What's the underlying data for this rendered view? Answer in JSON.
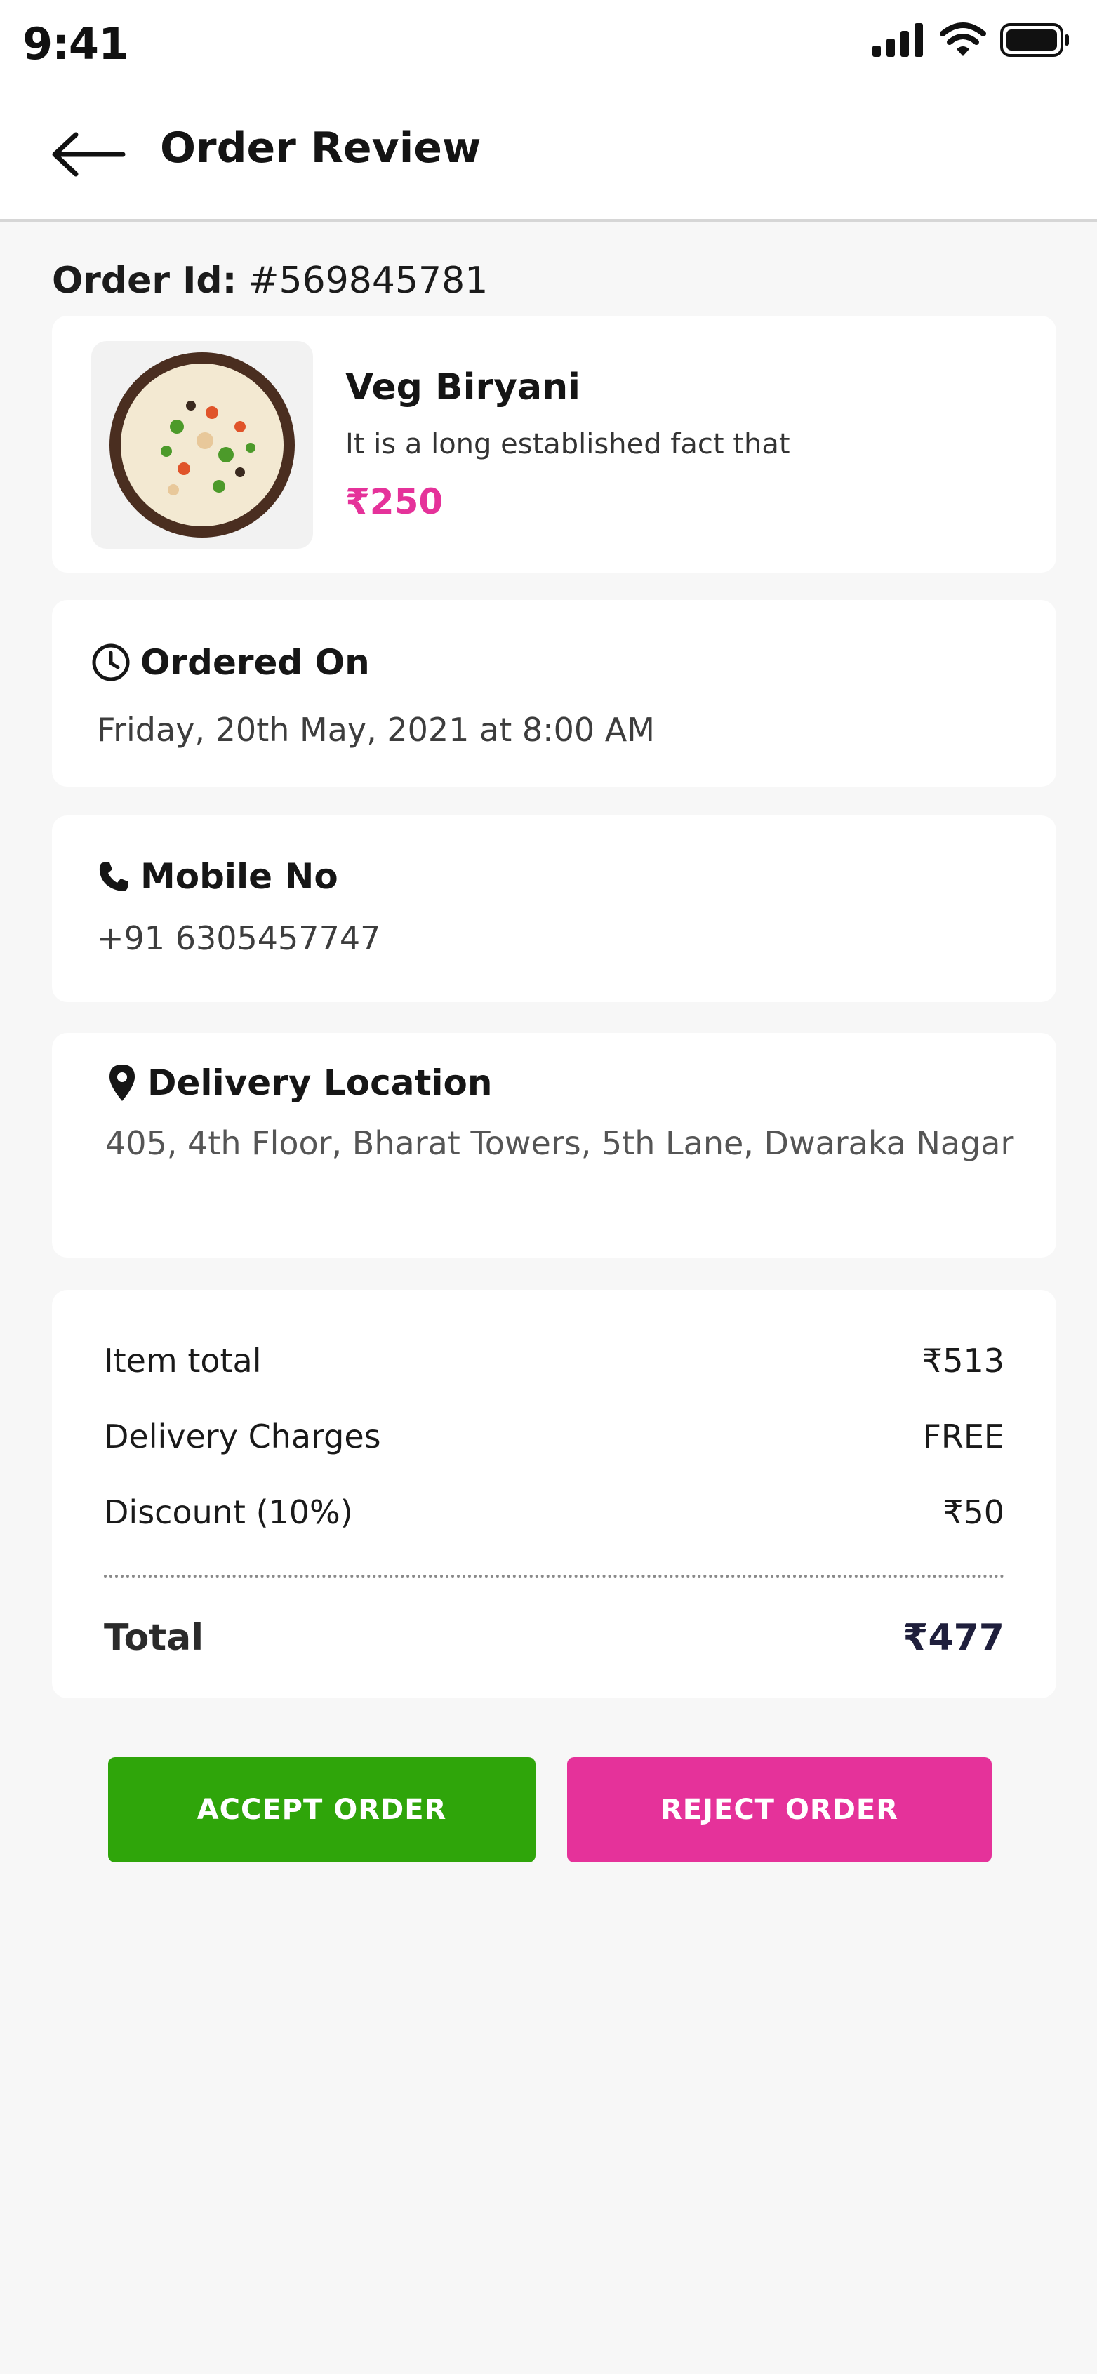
{
  "status_bar": {
    "time": "9:41"
  },
  "header": {
    "title": "Order Review"
  },
  "order": {
    "id_label": "Order Id:",
    "id_value": "#569845781"
  },
  "item": {
    "name": "Veg Biryani",
    "description": "It is a long established fact that",
    "price": "₹250"
  },
  "ordered_on": {
    "label": "Ordered On",
    "value": "Friday, 20th May, 2021 at 8:00 AM"
  },
  "mobile": {
    "label": "Mobile No",
    "value": "+91 6305457747"
  },
  "delivery": {
    "label": "Delivery Location",
    "address": "405, 4th Floor, Bharat Towers, 5th Lane, Dwaraka Nagar"
  },
  "bill": {
    "rows": [
      {
        "label": "Item total",
        "value": "₹513"
      },
      {
        "label": "Delivery Charges",
        "value": "FREE"
      },
      {
        "label": "Discount (10%)",
        "value": "₹50"
      }
    ],
    "total_label": "Total",
    "total_value": "₹477"
  },
  "actions": {
    "accept": "ACCEPT ORDER",
    "reject": "REJECT ORDER"
  },
  "colors": {
    "accent_pink": "#e5329a",
    "accept_green": "#2fa50a"
  }
}
